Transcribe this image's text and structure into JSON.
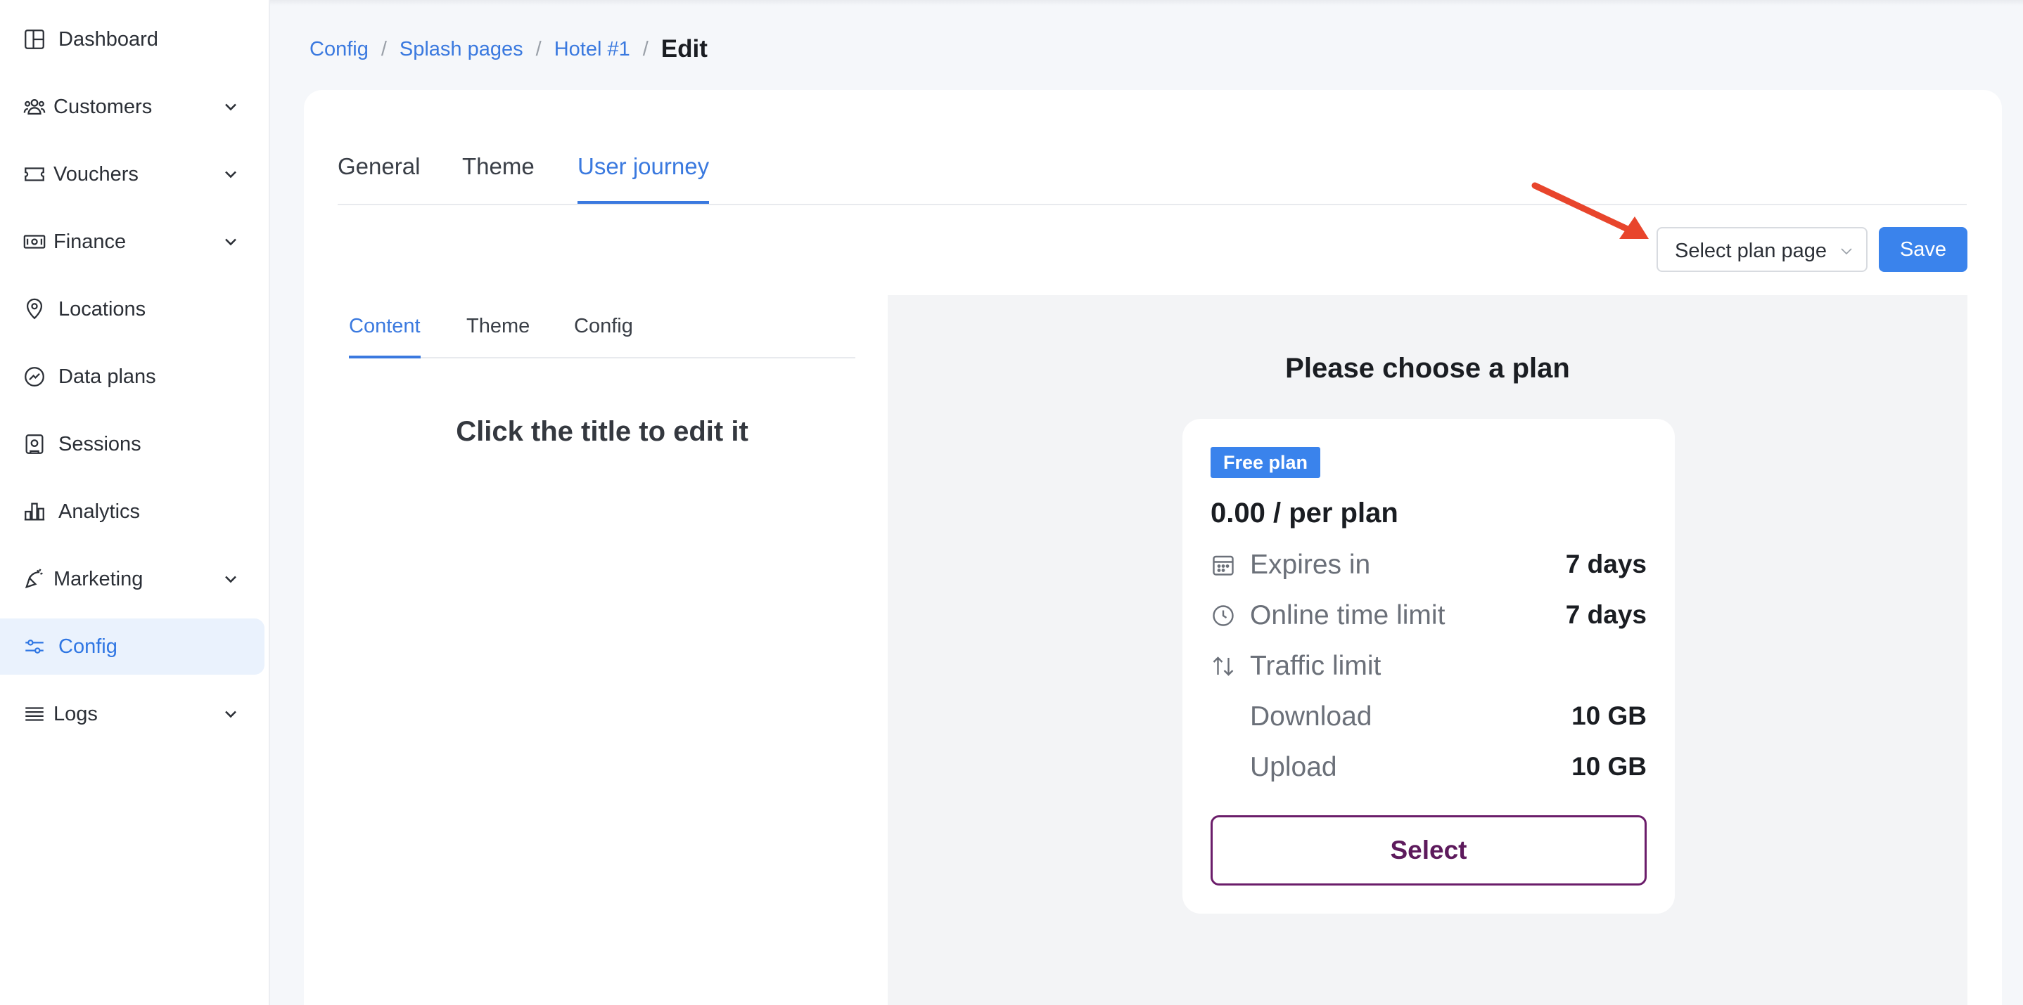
{
  "sidebar": {
    "items": [
      {
        "label": "Dashboard",
        "icon": "dashboard-icon"
      },
      {
        "label": "Customers",
        "icon": "customers-icon"
      },
      {
        "label": "Vouchers",
        "icon": "voucher-icon"
      },
      {
        "label": "Finance",
        "icon": "finance-icon"
      },
      {
        "label": "Locations",
        "icon": "location-pin-icon"
      },
      {
        "label": "Data plans",
        "icon": "data-plans-icon"
      },
      {
        "label": "Sessions",
        "icon": "sessions-icon"
      },
      {
        "label": "Analytics",
        "icon": "analytics-icon"
      },
      {
        "label": "Marketing",
        "icon": "marketing-icon"
      },
      {
        "label": "Config",
        "icon": "config-sliders-icon"
      },
      {
        "label": "Logs",
        "icon": "logs-icon"
      }
    ],
    "active": "Config",
    "accent": "#2f76e3"
  },
  "breadcrumb": {
    "items": [
      "Config",
      "Splash pages",
      "Hotel #1"
    ],
    "current": "Edit",
    "separator": "/"
  },
  "tabs": {
    "items": [
      "General",
      "Theme",
      "User journey"
    ],
    "active": "User journey"
  },
  "toolbar": {
    "plan_select_label": "Select plan page",
    "save_label": "Save"
  },
  "subtabs": {
    "items": [
      "Content",
      "Theme",
      "Config"
    ],
    "active": "Content"
  },
  "editor": {
    "hint": "Click the title to edit it"
  },
  "preview": {
    "title": "Please choose a plan",
    "plan": {
      "badge": "Free plan",
      "price": "0.00 / per plan",
      "rows": [
        {
          "label": "Expires in",
          "value": "7 days",
          "icon": "calendar-icon"
        },
        {
          "label": "Online time limit",
          "value": "7 days",
          "icon": "clock-icon"
        },
        {
          "label": "Traffic limit",
          "value": "",
          "icon": "transfer-arrows-icon"
        },
        {
          "label": "Download",
          "value": "10 GB",
          "icon": ""
        },
        {
          "label": "Upload",
          "value": "10 GB",
          "icon": ""
        }
      ],
      "select_label": "Select",
      "button_color": "#6b1d6a"
    }
  },
  "colors": {
    "primary": "#3a83ec",
    "annotation_arrow": "#e8452c"
  }
}
